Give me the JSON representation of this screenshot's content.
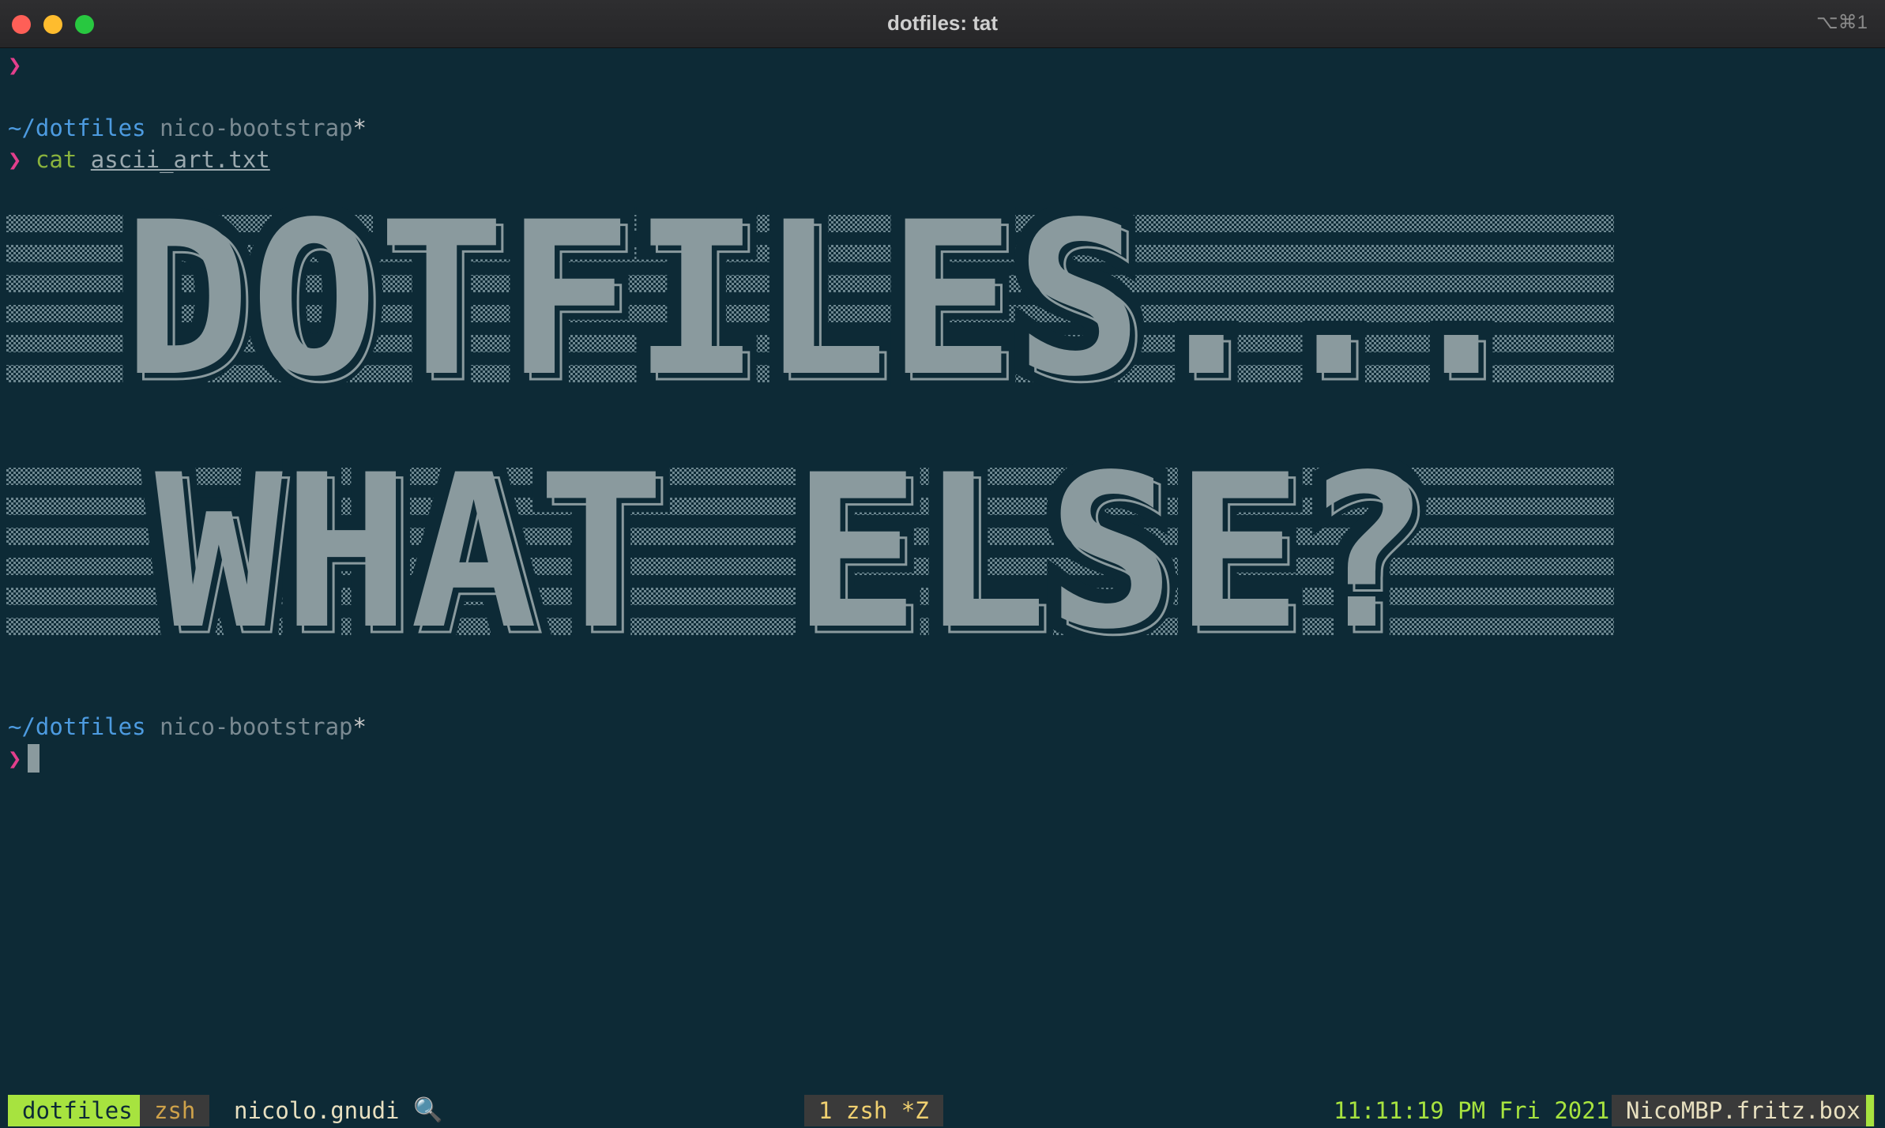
{
  "window": {
    "title": "dotfiles: tat",
    "shortcut": "⌥⌘1"
  },
  "terminal": {
    "prompt_symbol": "❯",
    "prompt1": {
      "path": "~/dotfiles",
      "branch": "nico-bootstrap",
      "dirty": "*"
    },
    "command": {
      "name": "cat",
      "argument": "ascii_art.txt"
    },
    "ascii_art": {
      "line1": "DOTFILES...",
      "line2": "WHAT ELSE?"
    },
    "prompt2": {
      "path": "~/dotfiles",
      "branch": "nico-bootstrap",
      "dirty": "*"
    }
  },
  "statusbar": {
    "session": "dotfiles",
    "shell": "zsh",
    "user": "nicolo.gnudi",
    "search_icon": "🔍",
    "window_label": "1 zsh *Z",
    "datetime": "11:11:19 PM Fri 2021",
    "hostname": "NicoMBP.fritz.box"
  },
  "colors": {
    "background": "#0d2a36",
    "prompt": "#e23f8c",
    "path": "#4d9be0",
    "command": "#8ab33d",
    "session_accent": "#a7e33f",
    "ascii_fill": "#8a9a9e"
  }
}
